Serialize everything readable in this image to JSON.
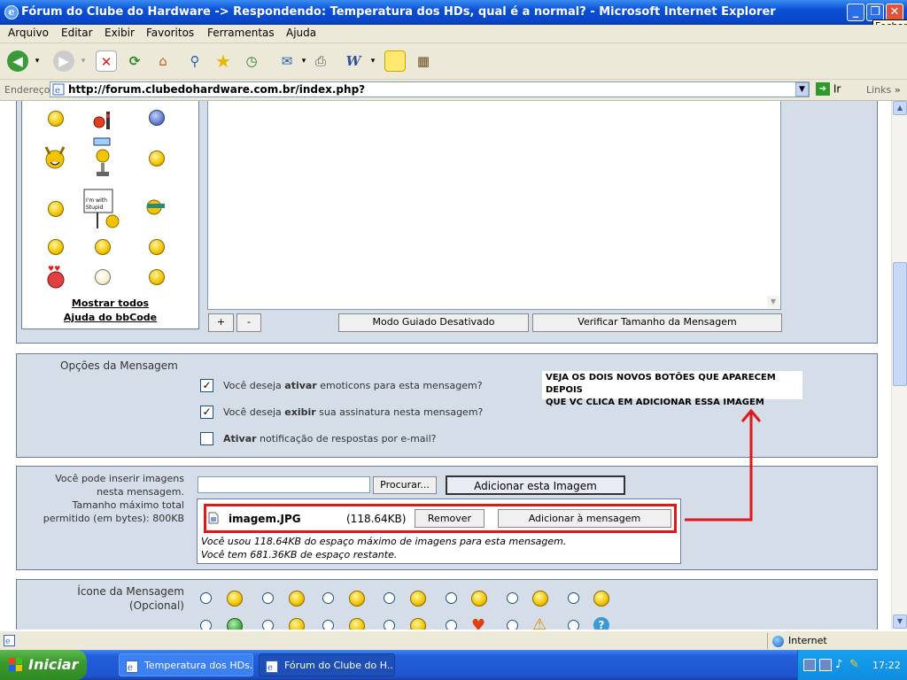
{
  "window": {
    "title": "Fórum do Clube do Hardware -> Respondendo: Temperatura dos HDs, qual é a normal? - Microsoft Internet Explorer",
    "close_tooltip": "Fechar"
  },
  "menu": [
    "Arquivo",
    "Editar",
    "Exibir",
    "Favoritos",
    "Ferramentas",
    "Ajuda"
  ],
  "address": {
    "label": "Endereço",
    "url": "http://forum.clubedohardware.com.br/index.php?",
    "go": "Ir",
    "links": "Links"
  },
  "smilies_panel": {
    "show_all": "Mostrar todos",
    "bbcode_help": "Ajuda do bbCode",
    "sign_text": "I'm with Stupid"
  },
  "editor": {
    "plus": "+",
    "minus": "-",
    "guided_mode": "Modo Guiado Desativado",
    "check_size": "Verificar Tamanho da Mensagem"
  },
  "options": {
    "title": "Opções da Mensagem",
    "opt1": {
      "pre": "Você deseja ",
      "bold": "ativar",
      "post": " emoticons para esta mensagem?",
      "checked": true
    },
    "opt2": {
      "pre": "Você deseja ",
      "bold": "exibir",
      "post": " sua assinatura nesta mensagem?",
      "checked": true
    },
    "opt3": {
      "pre": "",
      "bold": "Ativar",
      "post": " notificação de respostas por e-mail?",
      "checked": false
    },
    "annotation_line1": "VEJA OS DOIS NOVOS BOTÕES QUE APARECEM DEPOIS",
    "annotation_line2": "QUE VC CLICA EM ADICIONAR ESSA IMAGEM"
  },
  "images": {
    "info_line1": "Você pode inserir imagens",
    "info_line2": "nesta mensagem.",
    "info_line3": "Tamanho máximo total",
    "info_line4": "permitido (em bytes): 800KB",
    "browse": "Procurar...",
    "add_image": "Adicionar esta Imagem",
    "file_name": "imagem.JPG",
    "file_size": "(118.64KB)",
    "remove": "Remover",
    "add_to_message": "Adicionar à mensagem",
    "usage_line1": "Você usou 118.64KB do espaço máximo de imagens para esta mensagem.",
    "usage_line2": "Você tem 681.36KB de espaço restante."
  },
  "icon_section": {
    "title": "Ícone da Mensagem",
    "subtitle": "(Opcional)"
  },
  "status": {
    "zone": "Internet"
  },
  "taskbar": {
    "start": "Iniciar",
    "task1": "Temperatura dos HDs...",
    "task2": "Fórum do Clube do H...",
    "clock": "17:22"
  },
  "colors": {
    "annotation_red": "#e01818",
    "panel_bg": "#d5dde8"
  }
}
